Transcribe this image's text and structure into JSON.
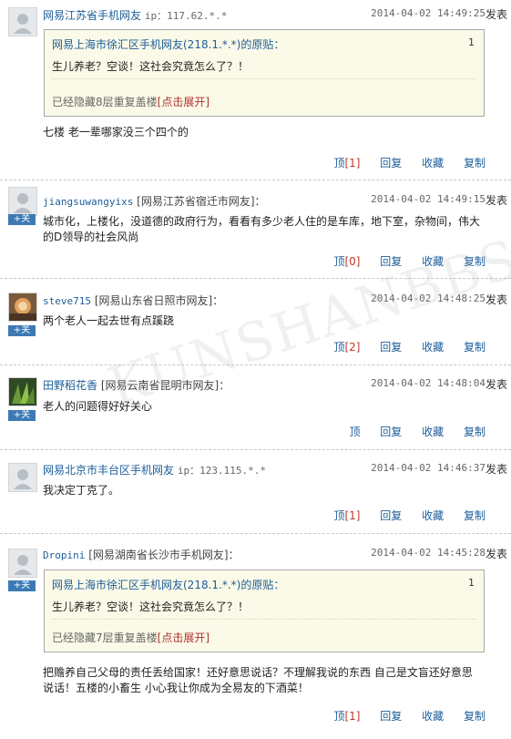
{
  "labels": {
    "post": "发表",
    "follow": "+关",
    "reply": "回复",
    "save": "收藏",
    "copy": "复制",
    "top": "顶",
    "expand": "[点击展开]"
  },
  "comments": [
    {
      "user": "网易江苏省手机网友",
      "source": "",
      "ip": "ip：117.62.*.*",
      "time": "2014-04-02 14:49:25",
      "quote": {
        "head": "网易上海市徐汇区手机网友(218.1.*.*)的原贴：",
        "floor": "1",
        "text": "生儿养老？空谈！这社会究竟怎么了？！",
        "hidden": "已经隐藏8层重复盖楼"
      },
      "text": "七楼 老一辈哪家没三个四个的",
      "top_count": "[1]"
    },
    {
      "user": "jiangsuwangyixs",
      "source": "[网易江苏省宿迁市网友]：",
      "time": "2014-04-02 14:49:15",
      "text": "城市化，上楼化，没道德的政府行为，看看有多少老人住的是车库，地下室，杂物间，伟大的D领导的社会风尚",
      "top_count": "[0]"
    },
    {
      "user": "steve715",
      "source": "[网易山东省日照市网友]：",
      "time": "2014-04-02 14:48:25",
      "text": "两个老人一起去世有点蹊跷",
      "top_count": "[2]"
    },
    {
      "user": "田野稻花香",
      "source": "[网易云南省昆明市网友]：",
      "time": "2014-04-02 14:48:04",
      "text": "老人的问题得好好关心",
      "top_count": ""
    },
    {
      "user": "网易北京市丰台区手机网友",
      "source": "",
      "ip": "ip：123.115.*.*",
      "time": "2014-04-02 14:46:37",
      "text": "我决定丁克了。",
      "top_count": "[1]"
    },
    {
      "user": "Dropini",
      "source": "[网易湖南省长沙市手机网友]：",
      "time": "2014-04-02 14:45:28",
      "quote": {
        "head": "网易上海市徐汇区手机网友(218.1.*.*)的原贴：",
        "floor": "1",
        "text": "生儿养老？空谈！这社会究竟怎么了？！",
        "hidden": "已经隐藏7层重复盖楼"
      },
      "text": "把赡养自己父母的责任丢给国家！还好意思说话？不理解我说的东西 自己是文盲还好意思说话！五楼的小畜生 小心我让你成为全易友的下酒菜！",
      "top_count": "[1]"
    }
  ],
  "watermark": "KUNSHANBBS"
}
